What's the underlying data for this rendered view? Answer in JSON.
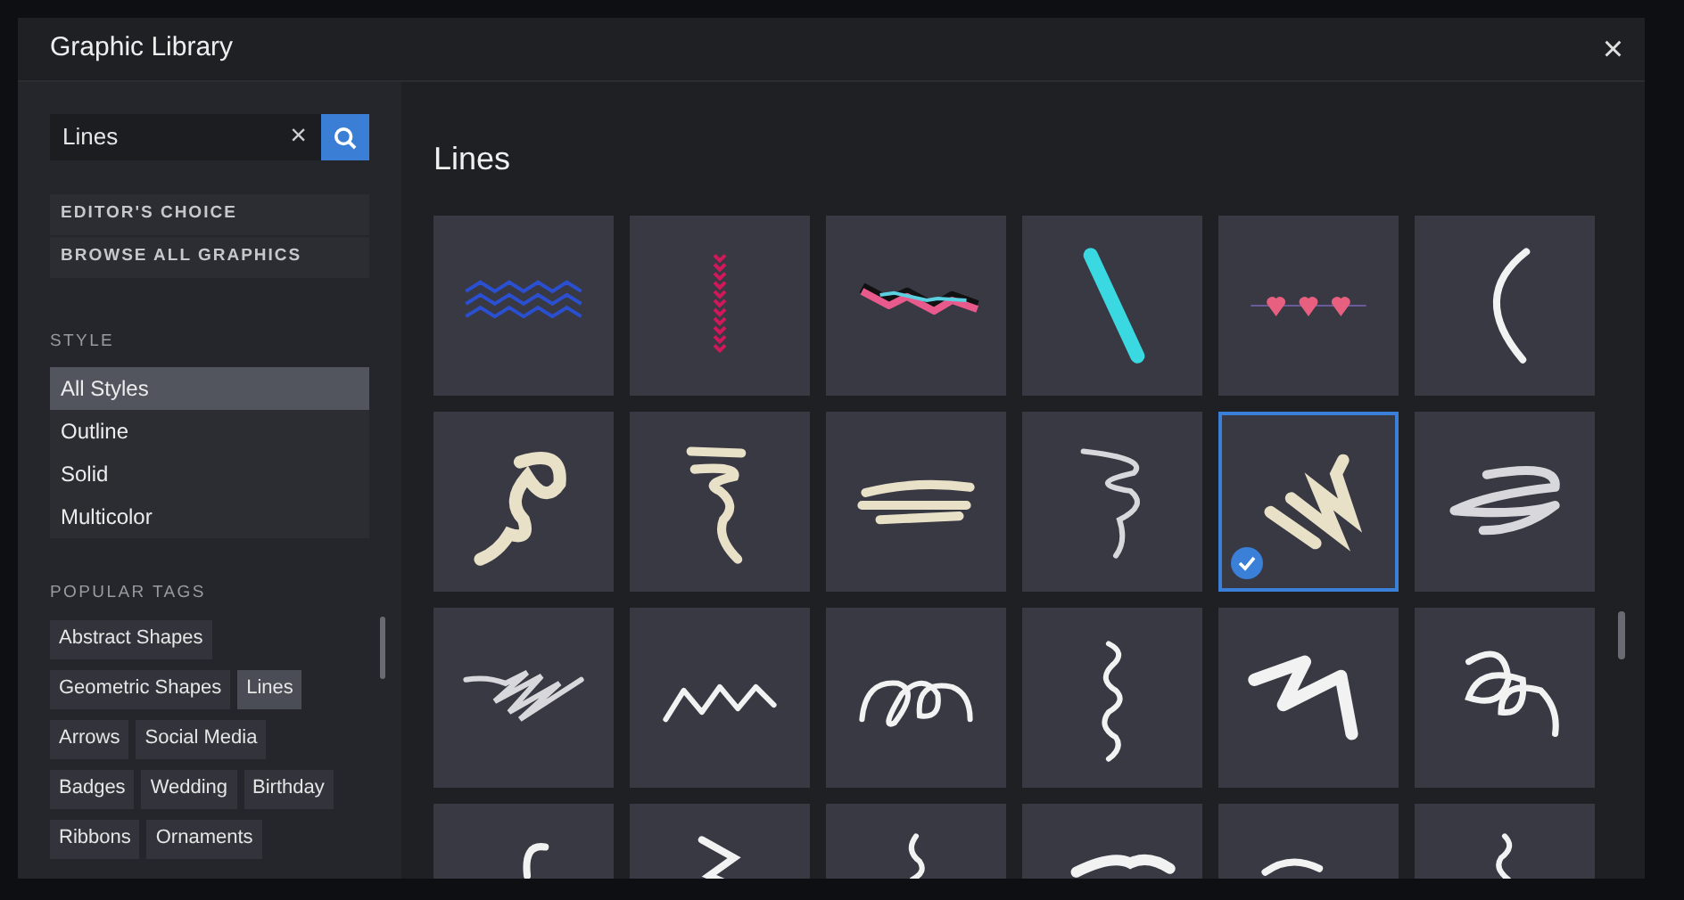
{
  "window": {
    "title": "Graphic Library",
    "close": "×"
  },
  "search": {
    "value": "Lines",
    "clear": "×"
  },
  "nav_buttons": [
    "EDITOR'S CHOICE",
    "BROWSE ALL GRAPHICS"
  ],
  "style": {
    "heading": "STYLE",
    "items": [
      {
        "label": "All Styles",
        "selected": true
      },
      {
        "label": "Outline",
        "selected": false
      },
      {
        "label": "Solid",
        "selected": false
      },
      {
        "label": "Multicolor",
        "selected": false
      }
    ]
  },
  "popular_tags": {
    "heading": "POPULAR TAGS",
    "tags": [
      {
        "label": "Abstract Shapes",
        "selected": false
      },
      {
        "label": "Geometric Shapes",
        "selected": false
      },
      {
        "label": "Lines",
        "selected": true
      },
      {
        "label": "Arrows",
        "selected": false
      },
      {
        "label": "Social Media",
        "selected": false
      },
      {
        "label": "Badges",
        "selected": false
      },
      {
        "label": "Wedding",
        "selected": false
      },
      {
        "label": "Birthday",
        "selected": false
      },
      {
        "label": "Ribbons",
        "selected": false
      },
      {
        "label": "Ornaments",
        "selected": false
      }
    ]
  },
  "results": {
    "title": "Lines",
    "graphics": [
      {
        "kind": "waves",
        "selected": false
      },
      {
        "kind": "chevrons",
        "selected": false
      },
      {
        "kind": "ribbon",
        "selected": false
      },
      {
        "kind": "bar",
        "selected": false
      },
      {
        "kind": "hearts",
        "selected": false
      },
      {
        "kind": "arc",
        "selected": false
      },
      {
        "kind": "squiggle",
        "selected": false
      },
      {
        "kind": "tornado",
        "selected": false
      },
      {
        "kind": "swipes",
        "selected": false
      },
      {
        "kind": "swirl",
        "selected": false
      },
      {
        "kind": "scrawl",
        "selected": true
      },
      {
        "kind": "coilbrush",
        "selected": false
      },
      {
        "kind": "hatch",
        "selected": false
      },
      {
        "kind": "wave",
        "selected": false
      },
      {
        "kind": "loops",
        "selected": false
      },
      {
        "kind": "wiggle",
        "selected": false
      },
      {
        "kind": "bolt",
        "selected": false
      },
      {
        "kind": "curls",
        "selected": false
      },
      {
        "kind": "hook",
        "selected": false
      },
      {
        "kind": "zed",
        "selected": false
      },
      {
        "kind": "twist",
        "selected": false
      },
      {
        "kind": "splash",
        "selected": false
      },
      {
        "kind": "hump",
        "selected": false
      },
      {
        "kind": "squig",
        "selected": false
      }
    ]
  }
}
